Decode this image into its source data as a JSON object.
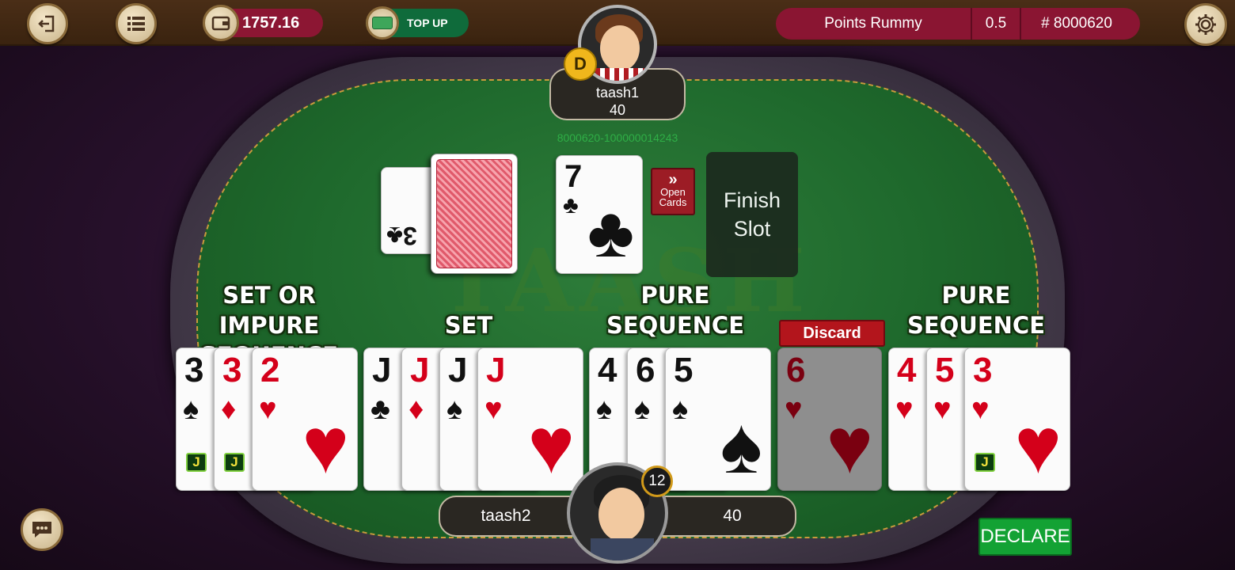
{
  "topbar": {
    "wallet_amount": "1757.16",
    "topup_label": "TOP UP",
    "game_type": "Points Rummy",
    "point_value": "0.5",
    "table_id": "# 8000620"
  },
  "table": {
    "watermark": "TAASH",
    "round_id": "8000620-100000014243",
    "open_cards_label": [
      "Open",
      "Cards"
    ],
    "finish_slot_label": [
      "Finish",
      "Slot"
    ],
    "closed_peek_card": {
      "rank": "3",
      "suit": "♣"
    },
    "open_card": {
      "rank": "7",
      "suit": "♣"
    }
  },
  "opponent": {
    "name": "taash1",
    "score": "40",
    "dealer_mark": "D"
  },
  "player": {
    "name": "taash2",
    "score": "40",
    "timer": "12"
  },
  "groups": [
    {
      "label": [
        "SET OR IMPURE",
        "SEQUENCE"
      ]
    },
    {
      "label": [
        "SET"
      ]
    },
    {
      "label": [
        "PURE",
        "SEQUENCE"
      ]
    },
    {
      "label": [
        "PURE",
        "SEQUENCE"
      ]
    }
  ],
  "hand": [
    {
      "rank": "3",
      "suit": "♠",
      "color": "#111111",
      "joker": "J"
    },
    {
      "rank": "3",
      "suit": "♦",
      "color": "#d4001a",
      "joker": "J"
    },
    {
      "rank": "2",
      "suit": "♥",
      "color": "#d4001a"
    },
    {
      "rank": "J",
      "suit": "♣",
      "color": "#111111"
    },
    {
      "rank": "J",
      "suit": "♦",
      "color": "#d4001a"
    },
    {
      "rank": "J",
      "suit": "♠",
      "color": "#111111"
    },
    {
      "rank": "J",
      "suit": "♥",
      "color": "#d4001a"
    },
    {
      "rank": "4",
      "suit": "♠",
      "color": "#111111"
    },
    {
      "rank": "6",
      "suit": "♠",
      "color": "#111111"
    },
    {
      "rank": "5",
      "suit": "♠",
      "color": "#111111"
    },
    {
      "rank": "6",
      "suit": "♥",
      "color": "#d4001a",
      "selected": true
    },
    {
      "rank": "4",
      "suit": "♥",
      "color": "#d4001a"
    },
    {
      "rank": "5",
      "suit": "♥",
      "color": "#d4001a"
    },
    {
      "rank": "3",
      "suit": "♥",
      "color": "#d4001a",
      "joker": "J"
    }
  ],
  "actions": {
    "discard_label": "Discard",
    "declare_label": "DECLARE"
  },
  "icons": [
    "exit-icon",
    "menu-icon",
    "wallet-icon",
    "cash-icon",
    "settings-icon",
    "chat-icon"
  ]
}
